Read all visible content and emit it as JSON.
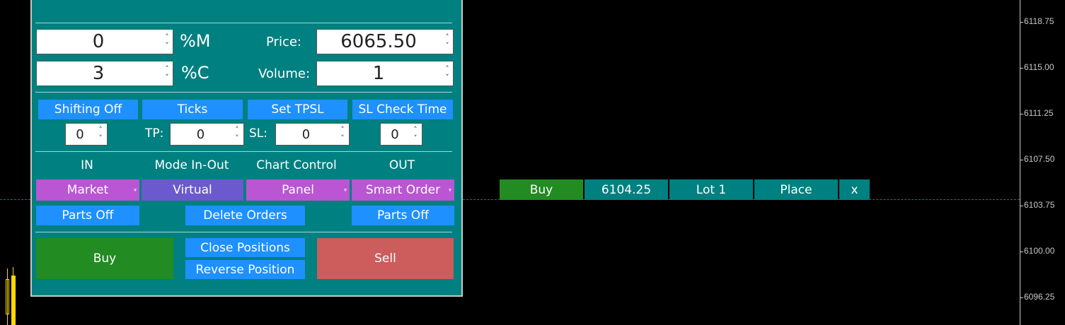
{
  "price_scale": {
    "labels": [
      "6118.75",
      "6115.00",
      "6111.25",
      "6107.50",
      "6103.75",
      "6100.00",
      "6096.25"
    ]
  },
  "panel": {
    "fields": {
      "pct_m": {
        "value": "0",
        "suffix": "%M"
      },
      "pct_c": {
        "value": "3",
        "suffix": "%C"
      },
      "price": {
        "label": "Price:",
        "value": "6065.50"
      },
      "volume": {
        "label": "Volume:",
        "value": "1"
      }
    },
    "row_buttons": {
      "shifting": "Shifting Off",
      "ticks": "Ticks",
      "set_tpsl": "Set TPSL",
      "sl_check_time": "SL Check Time"
    },
    "spinners": {
      "shift_value": "0",
      "tp_label": "TP:",
      "tp_value": "0",
      "sl_label": "SL:",
      "sl_value": "0",
      "check_time_value": "0"
    },
    "mode_headers": {
      "in": "IN",
      "mode_in_out": "Mode In-Out",
      "chart_control": "Chart Control",
      "out": "OUT"
    },
    "mode_selects": {
      "in": "Market",
      "mode": "Virtual",
      "chart_control": "Panel",
      "out": "Smart Order"
    },
    "parts_in": "Parts Off",
    "delete_orders": "Delete Orders",
    "parts_out": "Parts Off",
    "buy": "Buy",
    "close_positions": "Close Positions",
    "reverse_position": "Reverse Position",
    "sell": "Sell",
    "colors": {
      "background": "#008080",
      "buy": "#228b22",
      "sell": "#cd5c5c",
      "button": "#1e90ff",
      "dropdown": "#ba55d3"
    }
  },
  "order_line": {
    "side": "Buy",
    "price": "6104.25",
    "lot": "Lot 1",
    "place": "Place",
    "close": "x"
  },
  "icons": {
    "spin_up": "˄",
    "spin_down": "˅",
    "dropdown": "▾"
  }
}
